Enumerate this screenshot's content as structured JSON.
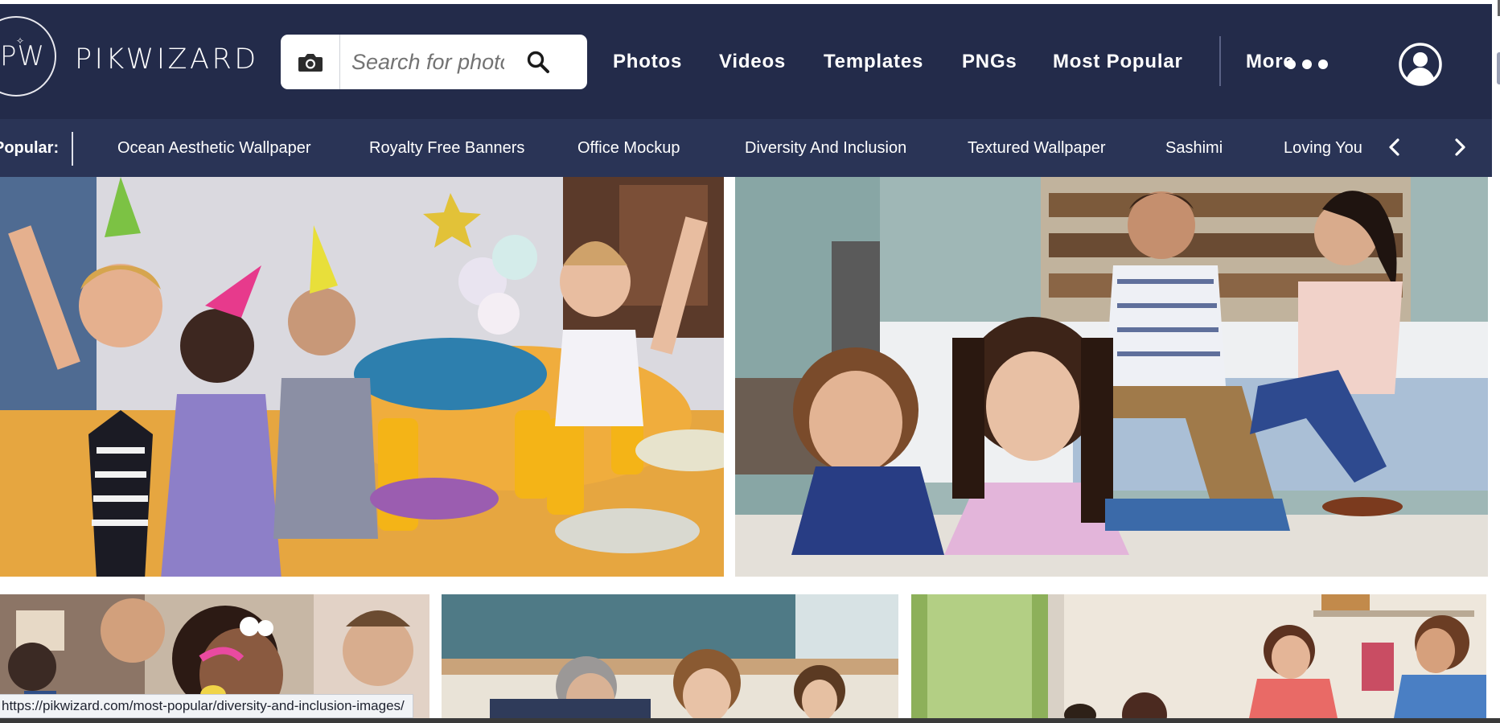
{
  "brand": {
    "name": "PIKWIZARD",
    "circle_text": "PW",
    "color_navy": "#232b4a",
    "color_navy_bar": "#2a3456"
  },
  "search": {
    "placeholder": "Search for photos",
    "camera_icon": "camera-icon",
    "search_icon": "search-icon"
  },
  "nav": {
    "items": [
      {
        "label": "Photos"
      },
      {
        "label": "Videos"
      },
      {
        "label": "Templates"
      },
      {
        "label": "PNGs"
      },
      {
        "label": "Most Popular"
      }
    ],
    "more_label": "More",
    "more_icon": "more-dots-icon",
    "user_icon": "user-account-icon"
  },
  "popular": {
    "label": "Popular:",
    "items": [
      {
        "label": "Ocean Aesthetic Wallpaper"
      },
      {
        "label": "Royalty Free Banners"
      },
      {
        "label": "Office Mockup"
      },
      {
        "label": "Diversity And Inclusion"
      },
      {
        "label": "Textured Wallpaper"
      },
      {
        "label": "Sashimi"
      },
      {
        "label": "Loving Yourself"
      }
    ],
    "prev_icon": "chevron-left-icon",
    "next_icon": "chevron-right-icon"
  },
  "gallery": {
    "images": [
      {
        "subject": "children celebrating at a birthday party"
      },
      {
        "subject": "children lying on floor covering ears while parents argue"
      },
      {
        "subject": "children with face paint"
      },
      {
        "subject": "family at table"
      },
      {
        "subject": "couple talking in kitchen"
      }
    ]
  },
  "status": {
    "url": "https://pikwizard.com/most-popular/diversity-and-inclusion-images/"
  }
}
